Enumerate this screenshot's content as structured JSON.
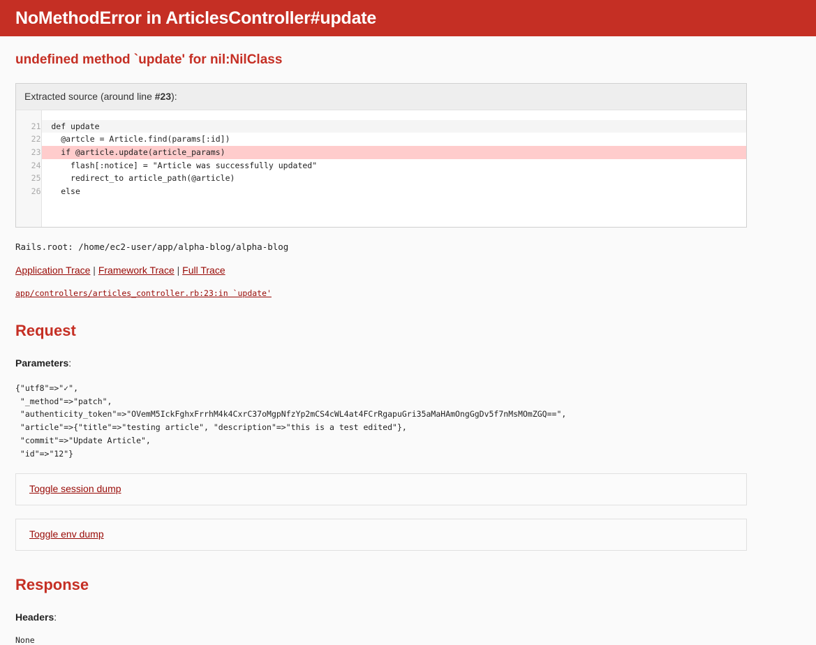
{
  "banner": {
    "title": "NoMethodError in ArticlesController#update",
    "background_color": "#c52f24",
    "text_color": "#ffffff"
  },
  "error": {
    "message": "undefined method `update' for nil:NilClass",
    "color": "#c52f24"
  },
  "source": {
    "header_prefix": "Extracted source (around line ",
    "header_line_number": "#23",
    "header_suffix": "):",
    "highlight_color": "#ffcccc",
    "lines": [
      {
        "number": "21",
        "code": "  def update",
        "state": "alt"
      },
      {
        "number": "22",
        "code": "    @artcle = Article.find(params[:id])",
        "state": "normal"
      },
      {
        "number": "23",
        "code": "    if @article.update(article_params)",
        "state": "highlight"
      },
      {
        "number": "24",
        "code": "      flash[:notice] = \"Article was successfully updated\"",
        "state": "normal"
      },
      {
        "number": "25",
        "code": "      redirect_to article_path(@article)",
        "state": "normal"
      },
      {
        "number": "26",
        "code": "    else",
        "state": "normal"
      }
    ]
  },
  "rails_root": "Rails.root: /home/ec2-user/app/alpha-blog/alpha-blog",
  "trace_links": {
    "application": "Application Trace",
    "framework": "Framework Trace",
    "full": "Full Trace",
    "separator": "|"
  },
  "trace_body": "app/controllers/articles_controller.rb:23:in `update'",
  "request": {
    "title": "Request",
    "parameters_label": "Parameters",
    "colon": ":",
    "parameters_dump": "{\"utf8\"=>\"✓\",\n \"_method\"=>\"patch\",\n \"authenticity_token\"=>\"OVemM5IckFghxFrrhM4k4CxrC37oMgpNfzYp2mCS4cWL4at4FCrRgapuGri35aMaHAmOngGgDv5f7nMsMOmZGQ==\",\n \"article\"=>{\"title\"=>\"testing article\", \"description\"=>\"this is a test edited\"},\n \"commit\"=>\"Update Article\",\n \"id\"=>\"12\"}",
    "toggle_session": "Toggle session dump",
    "toggle_env": "Toggle env dump"
  },
  "response": {
    "title": "Response",
    "headers_label": "Headers",
    "colon": ":",
    "headers_value": "None"
  },
  "link_color": "#980905"
}
